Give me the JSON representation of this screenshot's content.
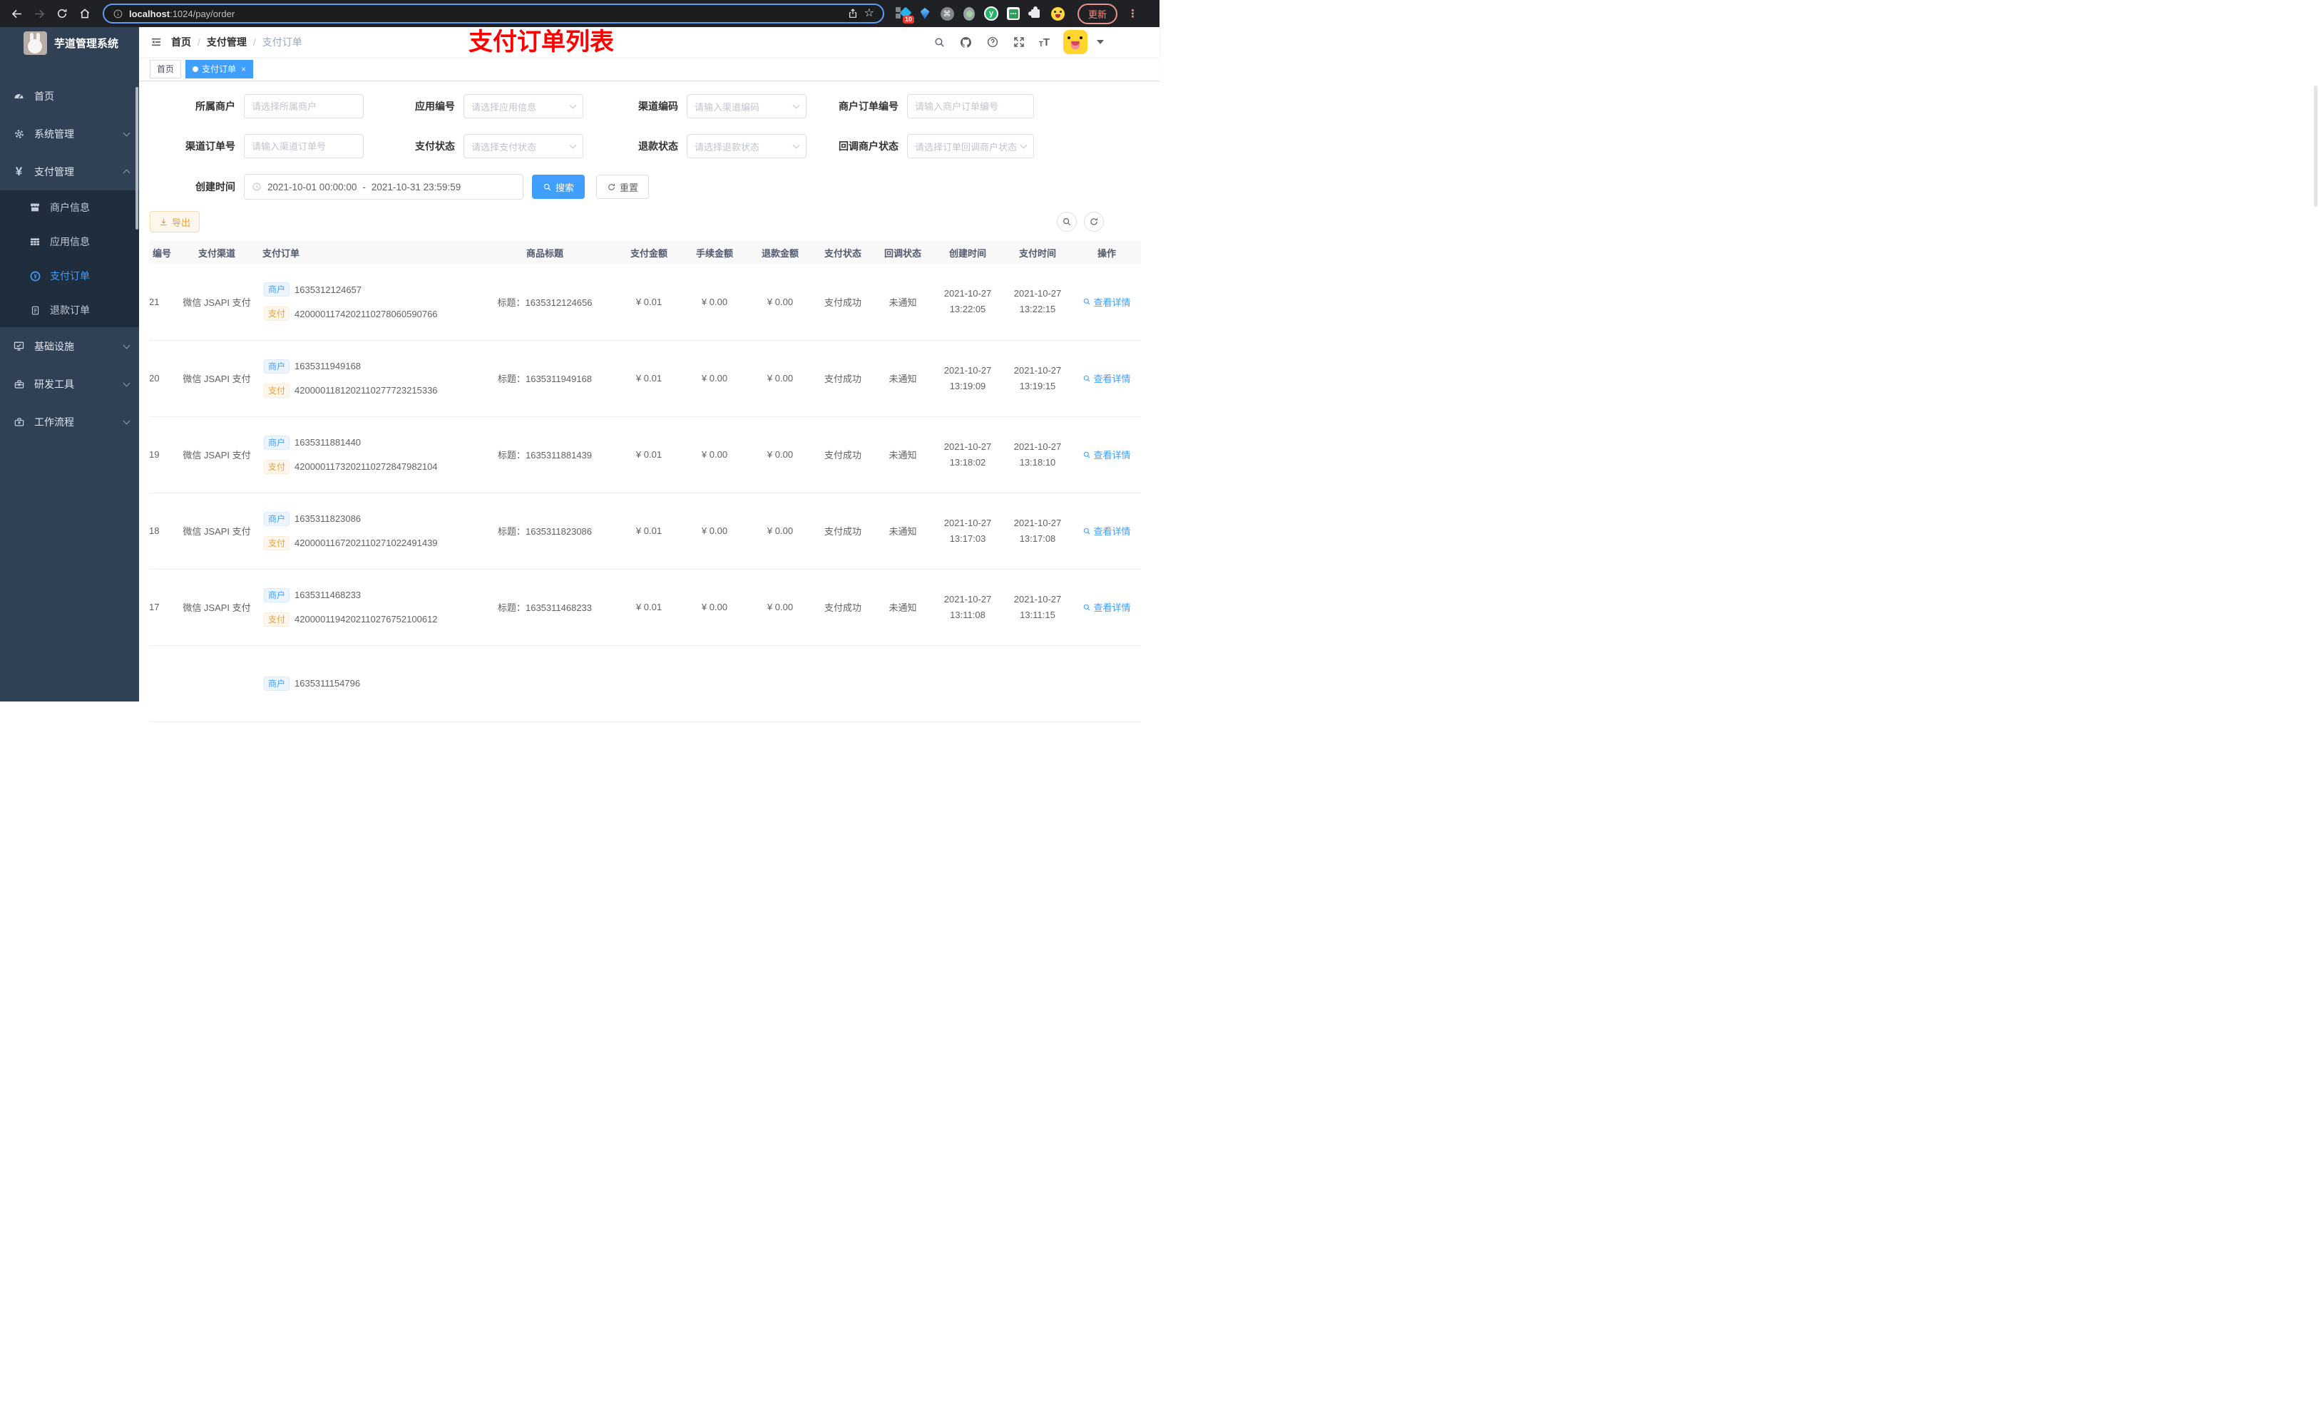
{
  "browser": {
    "url_host": "localhost",
    "url_rest": ":1024/pay/order",
    "extension_badge": "10",
    "cmd_glyph": "⌘",
    "y_glyph": "y",
    "star_glyph": "☆",
    "dots_glyph": "⋮",
    "update_label": "更新"
  },
  "sidebar": {
    "title": "芋道管理系统",
    "top_items": [
      {
        "label": "首页"
      },
      {
        "label": "系统管理"
      },
      {
        "label": "支付管理"
      }
    ],
    "pay_children": [
      {
        "label": "商户信息"
      },
      {
        "label": "应用信息"
      },
      {
        "label": "支付订单"
      },
      {
        "label": "退款订单"
      }
    ],
    "bottom_items": [
      {
        "label": "基础设施"
      },
      {
        "label": "研发工具"
      },
      {
        "label": "工作流程"
      }
    ],
    "yen_glyph": "¥"
  },
  "navbar": {
    "breadcrumb": [
      "首页",
      "支付管理",
      "支付订单"
    ],
    "separator": "/",
    "annotation": "支付订单列表"
  },
  "tags_view": {
    "home": "首页",
    "active": "支付订单",
    "close_glyph": "×"
  },
  "filters": {
    "fields": [
      {
        "label": "所属商户",
        "placeholder": "请选择所属商户",
        "type": "input"
      },
      {
        "label": "应用编号",
        "placeholder": "请选择应用信息",
        "type": "select"
      },
      {
        "label": "渠道编码",
        "placeholder": "请输入渠道编码",
        "type": "select"
      },
      {
        "label": "商户订单编号",
        "placeholder": "请输入商户订单编号",
        "type": "input"
      },
      {
        "label": "渠道订单号",
        "placeholder": "请输入渠道订单号",
        "type": "input"
      },
      {
        "label": "支付状态",
        "placeholder": "请选择支付状态",
        "type": "select"
      },
      {
        "label": "退款状态",
        "placeholder": "请选择退款状态",
        "type": "select"
      },
      {
        "label": "回调商户状态",
        "placeholder": "请选择订单回调商户状态",
        "type": "select"
      }
    ],
    "date": {
      "label": "创建时间",
      "start": "2021-10-01 00:00:00",
      "separator": "-",
      "end": "2021-10-31 23:59:59"
    },
    "search_label": "搜索",
    "reset_label": "重置"
  },
  "toolbar": {
    "export_label": "导出"
  },
  "table": {
    "headers": [
      "编号",
      "支付渠道",
      "支付订单",
      "商品标题",
      "支付金额",
      "手续金额",
      "退款金额",
      "支付状态",
      "回调状态",
      "创建时间",
      "支付时间",
      "操作"
    ],
    "tag_merchant": "商户",
    "tag_pay": "支付",
    "action_label": "查看详情",
    "rows": [
      {
        "id": "21",
        "channel": "微信 JSAPI 支付",
        "merchant_no": "1635312124657",
        "pay_no": "4200001174202110278060590766",
        "title": "标题：1635312124656",
        "amount": "¥ 0.01",
        "fee": "¥ 0.00",
        "refund": "¥ 0.00",
        "pay_status": "支付成功",
        "notify_status": "未通知",
        "created_date": "2021-10-27",
        "created_time": "13:22:05",
        "paid_date": "2021-10-27",
        "paid_time": "13:22:15"
      },
      {
        "id": "20",
        "channel": "微信 JSAPI 支付",
        "merchant_no": "1635311949168",
        "pay_no": "4200001181202110277723215336",
        "title": "标题：1635311949168",
        "amount": "¥ 0.01",
        "fee": "¥ 0.00",
        "refund": "¥ 0.00",
        "pay_status": "支付成功",
        "notify_status": "未通知",
        "created_date": "2021-10-27",
        "created_time": "13:19:09",
        "paid_date": "2021-10-27",
        "paid_time": "13:19:15"
      },
      {
        "id": "19",
        "channel": "微信 JSAPI 支付",
        "merchant_no": "1635311881440",
        "pay_no": "4200001173202110272847982104",
        "title": "标题：1635311881439",
        "amount": "¥ 0.01",
        "fee": "¥ 0.00",
        "refund": "¥ 0.00",
        "pay_status": "支付成功",
        "notify_status": "未通知",
        "created_date": "2021-10-27",
        "created_time": "13:18:02",
        "paid_date": "2021-10-27",
        "paid_time": "13:18:10"
      },
      {
        "id": "18",
        "channel": "微信 JSAPI 支付",
        "merchant_no": "1635311823086",
        "pay_no": "4200001167202110271022491439",
        "title": "标题：1635311823086",
        "amount": "¥ 0.01",
        "fee": "¥ 0.00",
        "refund": "¥ 0.00",
        "pay_status": "支付成功",
        "notify_status": "未通知",
        "created_date": "2021-10-27",
        "created_time": "13:17:03",
        "paid_date": "2021-10-27",
        "paid_time": "13:17:08"
      },
      {
        "id": "17",
        "channel": "微信 JSAPI 支付",
        "merchant_no": "1635311468233",
        "pay_no": "4200001194202110276752100612",
        "title": "标题：1635311468233",
        "amount": "¥ 0.01",
        "fee": "¥ 0.00",
        "refund": "¥ 0.00",
        "pay_status": "支付成功",
        "notify_status": "未通知",
        "created_date": "2021-10-27",
        "created_time": "13:11:08",
        "paid_date": "2021-10-27",
        "paid_time": "13:11:15"
      },
      {
        "id": "",
        "channel": "",
        "merchant_no": "1635311154796",
        "pay_no": "",
        "title": "",
        "amount": "",
        "fee": "",
        "refund": "",
        "pay_status": "",
        "notify_status": "",
        "created_date": "",
        "created_time": "",
        "paid_date": "",
        "paid_time": "",
        "partial": true
      }
    ]
  },
  "colors": {
    "accent": "#409eff",
    "warning": "#e6a23c",
    "annotation_red": "#fe0000",
    "sidebar_bg": "#304156",
    "submenu_bg": "#1f2d3d"
  }
}
